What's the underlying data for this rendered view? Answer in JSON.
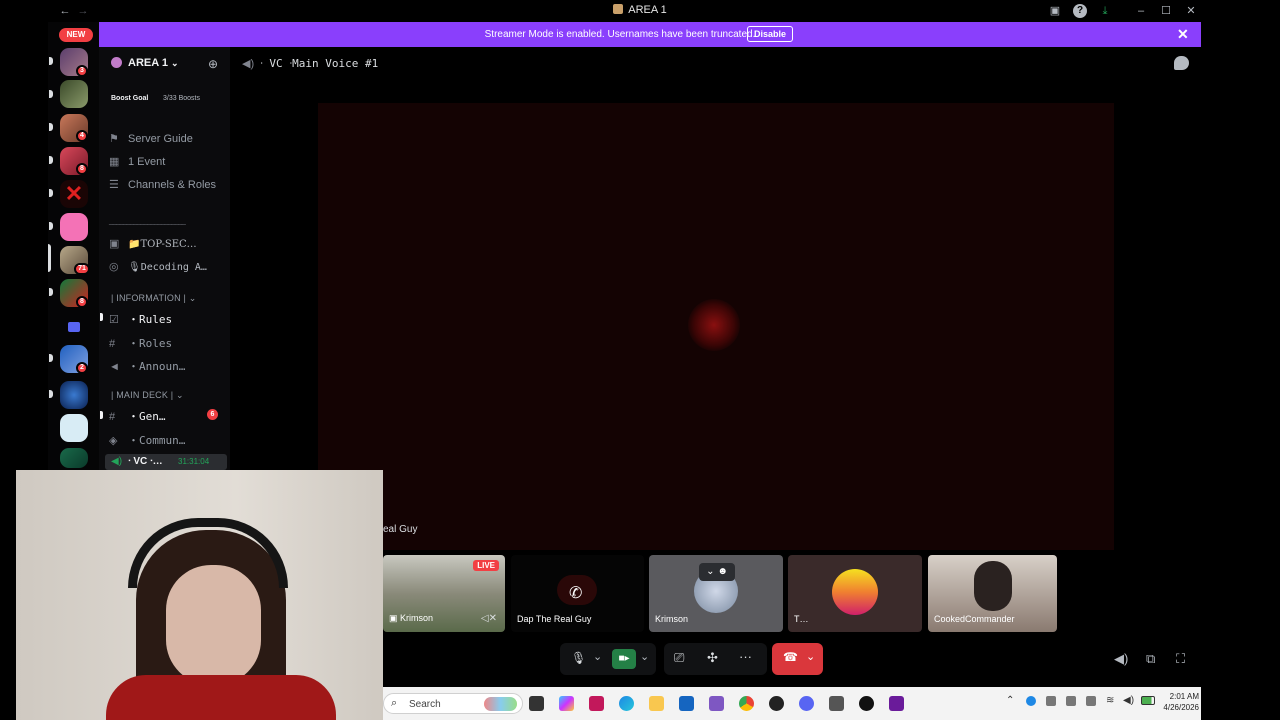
{
  "window": {
    "title": "AREA 1"
  },
  "banner": {
    "message": "Streamer Mode is enabled. Usernames have been truncated.",
    "button": "Disable"
  },
  "rail": {
    "new_badge": "NEW",
    "badges": [
      "3",
      "4",
      "8",
      "71",
      "8",
      "2"
    ]
  },
  "server": {
    "name": "AREA 1",
    "boost_label": "Boost Goal",
    "boost_count": "3/33 Boosts"
  },
  "sidebar": {
    "top_items": [
      "Server Guide",
      "1 Event",
      "Channels & Roles"
    ],
    "divider": "______________________",
    "channels_a": [
      "📁TOP-SEC…",
      "🎙Decoding A…"
    ],
    "cat_info": "| INFORMATION |",
    "info_channels": [
      "・Rules",
      "・Roles",
      "・Announ…"
    ],
    "cat_main": "| MAIN DECK |",
    "main_channels": [
      "・Gen…",
      "・Commun…"
    ],
    "gen_badge": "6",
    "voice_channel": "ᐧ VC ᐧ…",
    "voice_timer": "31:31:04"
  },
  "header": {
    "channel": "ᐧ VC ᐧMain Voice #1"
  },
  "stage": {
    "partial_name": "eal Guy"
  },
  "participants": [
    {
      "name": "Krimson",
      "live": "LIVE"
    },
    {
      "name": "Dap The Real Guy"
    },
    {
      "name": "Krimson"
    },
    {
      "name": "T…"
    },
    {
      "name": "CookedCommander"
    }
  ],
  "taskbar": {
    "search": "Search",
    "time": "2:01 AM",
    "date": "4/26/2026"
  },
  "colors": {
    "banner": "#8a3ffc",
    "hangup": "#da373c",
    "sidebar": "#0b0b0d",
    "video_bg": "#140303"
  }
}
